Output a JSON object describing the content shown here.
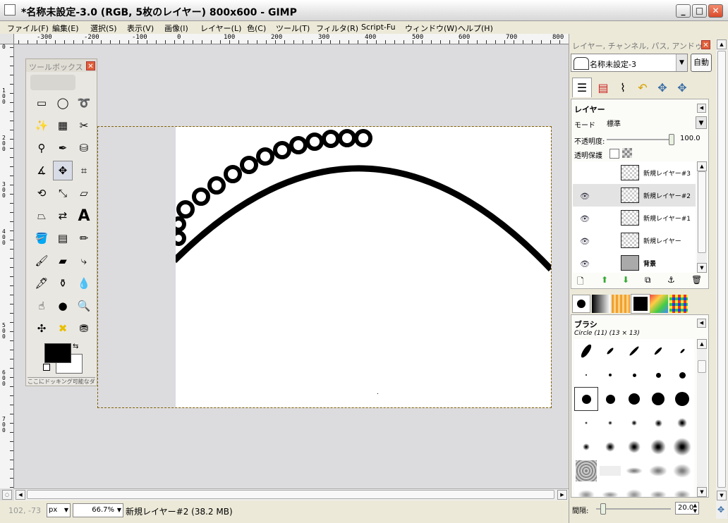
{
  "window": {
    "title": "*名称未設定-3.0 (RGB, 5枚のレイヤー) 800x600 - GIMP",
    "minimize": "_",
    "maximize": "□",
    "close": "✕"
  },
  "menu": [
    "ファイル(F)",
    "編集(E)",
    "選択(S)",
    "表示(V)",
    "画像(I)",
    "レイヤー(L)",
    "色(C)",
    "ツール(T)",
    "フィルタ(R)",
    "Script-Fu",
    "ウィンドウ(W)",
    "ヘルプ(H)"
  ],
  "ruler": {
    "h_labels": [
      "-300",
      "-200",
      "-100",
      "0",
      "100",
      "200",
      "300",
      "400",
      "500",
      "600",
      "700",
      "800"
    ],
    "v_labels": [
      "0",
      "1\n0\n0",
      "2\n0\n0",
      "3\n0\n0",
      "4\n0\n0",
      "5\n0\n0",
      "6\n0\n0",
      "7\n0\n0"
    ]
  },
  "toolbox": {
    "title": "ツールボックス",
    "close": "✕",
    "dock_hint": "ここにドッキング可能なダイアログ"
  },
  "statusbar": {
    "coords": "102, -73",
    "unit": "px",
    "zoom": "66.7%",
    "message": "新規レイヤー#2 (38.2 MB)"
  },
  "dock": {
    "title": "レイヤー, チャンネル, パス, アンドゥ...",
    "close": "✕",
    "image_name": "名称未設定-3",
    "auto_button": "自動",
    "layers": {
      "heading": "レイヤー",
      "mode_label": "モード",
      "mode_value": "標準",
      "opacity_label": "不透明度:",
      "opacity_value": "100.0",
      "opacity_fraction": 1.0,
      "lock_label": "透明保護",
      "items": [
        {
          "name": "新規レイヤー#3",
          "visible": false,
          "selected": false
        },
        {
          "name": "新規レイヤー#2",
          "visible": true,
          "selected": true
        },
        {
          "name": "新規レイヤー#1",
          "visible": true,
          "selected": false
        },
        {
          "name": "新規レイヤー",
          "visible": true,
          "selected": false
        },
        {
          "name": "背景",
          "visible": true,
          "selected": false
        }
      ]
    },
    "brushes": {
      "heading": "ブラシ",
      "current": "Circle (11) (13 × 13)",
      "spacing_label": "間隔:",
      "spacing_value": "20.0"
    }
  }
}
